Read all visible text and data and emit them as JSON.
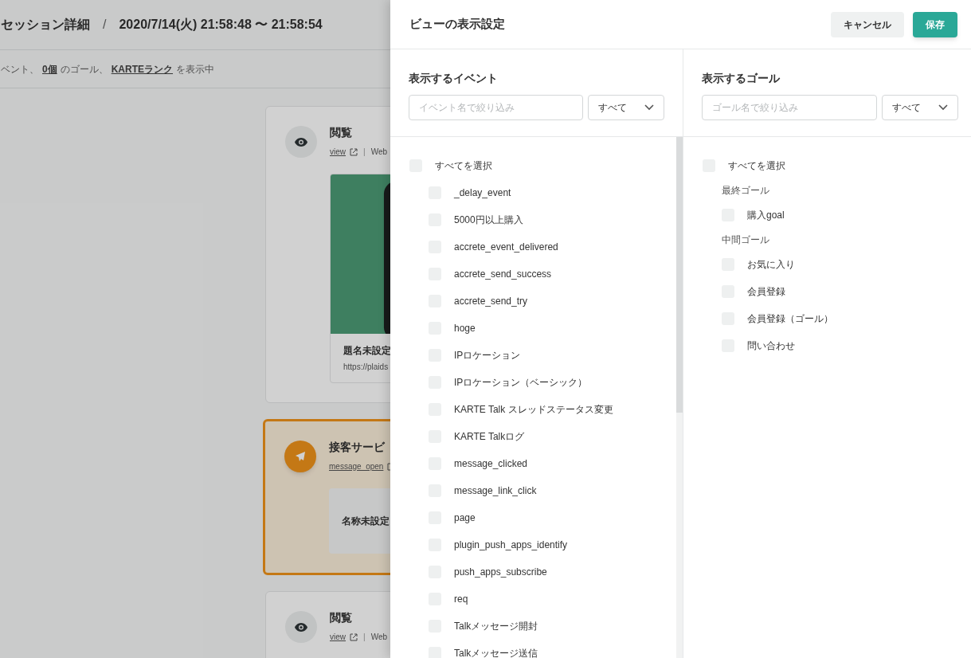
{
  "page": {
    "title": "セッション詳細",
    "separator": "/",
    "period": "2020/7/14(火) 21:58:48 〜 21:58:54",
    "summary": [
      {
        "kind": "text",
        "text": "ベント、"
      },
      {
        "kind": "link",
        "text": "0個"
      },
      {
        "kind": "text",
        "text": "のゴール、"
      },
      {
        "kind": "link",
        "text": "KARTEランク"
      },
      {
        "kind": "text",
        "text": "を表示中"
      }
    ],
    "cards": [
      {
        "kind": "view",
        "highlighted": false,
        "title": "閲覧",
        "event": "view",
        "separator": "|",
        "source": "Web",
        "preview": {
          "kind": "picture",
          "title": "題名未設定",
          "url": "https://plaids"
        }
      },
      {
        "kind": "message",
        "highlighted": true,
        "title": "接客サービ",
        "event": "message_open",
        "preview": {
          "kind": "note",
          "title": "名称未設定"
        }
      },
      {
        "kind": "view",
        "highlighted": false,
        "title": "閲覧",
        "event": "view",
        "separator": "|",
        "source": "Web"
      }
    ]
  },
  "dialog": {
    "title": "ビューの表示設定",
    "cancel": "キャンセル",
    "save": "保存",
    "events": {
      "heading": "表示するイベント",
      "search": {
        "placeholder": "イベント名で絞り込み"
      },
      "filter": "すべて",
      "select_all": {
        "label": "すべてを選択",
        "checked": false
      },
      "items": [
        {
          "label": "_delay_event",
          "checked": false
        },
        {
          "label": "5000円以上購入",
          "checked": false
        },
        {
          "label": "accrete_event_delivered",
          "checked": false
        },
        {
          "label": "accrete_send_success",
          "checked": false
        },
        {
          "label": "accrete_send_try",
          "checked": false
        },
        {
          "label": "hoge",
          "checked": false
        },
        {
          "label": "IPロケーション",
          "checked": false
        },
        {
          "label": "IPロケーション（ベーシック）",
          "checked": false
        },
        {
          "label": "KARTE Talk スレッドステータス変更",
          "checked": false
        },
        {
          "label": "KARTE Talkログ",
          "checked": false
        },
        {
          "label": "message_clicked",
          "checked": false
        },
        {
          "label": "message_link_click",
          "checked": false
        },
        {
          "label": "page",
          "checked": false
        },
        {
          "label": "plugin_push_apps_identify",
          "checked": false
        },
        {
          "label": "push_apps_subscribe",
          "checked": false
        },
        {
          "label": "req",
          "checked": false
        },
        {
          "label": "Talkメッセージ開封",
          "checked": false
        },
        {
          "label": "Talkメッセージ送信",
          "checked": false
        }
      ]
    },
    "goals": {
      "heading": "表示するゴール",
      "search": {
        "placeholder": "ゴール名で絞り込み"
      },
      "filter": "すべて",
      "select_all": {
        "label": "すべてを選択",
        "checked": false
      },
      "groups": [
        {
          "label": "最終ゴール",
          "items": [
            {
              "label": "購入goal",
              "checked": false
            }
          ]
        },
        {
          "label": "中間ゴール",
          "items": [
            {
              "label": "お気に入り",
              "checked": false
            },
            {
              "label": "会員登録",
              "checked": false
            },
            {
              "label": "会員登録（ゴール）",
              "checked": false
            },
            {
              "label": "問い合わせ",
              "checked": false
            }
          ]
        }
      ]
    }
  }
}
